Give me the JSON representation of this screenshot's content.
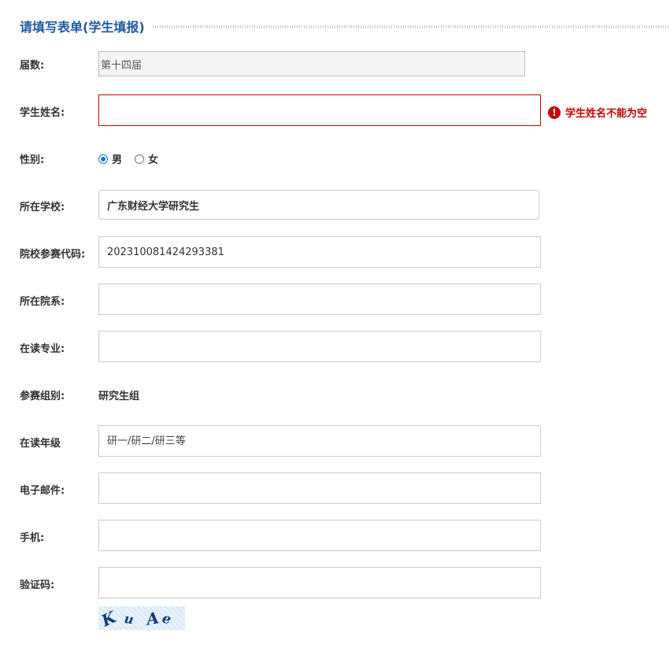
{
  "section": {
    "title": "请填写表单(学生填报)"
  },
  "form": {
    "session": {
      "label": "届数:",
      "value": "第十四届"
    },
    "student_name": {
      "label": "学生姓名:",
      "value": "",
      "error": "学生姓名不能为空",
      "error_icon": "exclamation-icon"
    },
    "gender": {
      "label": "性别:",
      "options": [
        "男",
        "女"
      ],
      "selected": "男"
    },
    "school": {
      "label": "所在学校:",
      "value": "广东财经大学研究生"
    },
    "school_code": {
      "label": "院校参赛代码:",
      "value": "202310081424293381"
    },
    "department": {
      "label": "所在院系:",
      "value": ""
    },
    "major": {
      "label": "在读专业:",
      "value": ""
    },
    "group": {
      "label": "参赛组别:",
      "value": "研究生组"
    },
    "grade": {
      "label": "在读年级",
      "placeholder": "研一/研二/研三等",
      "value": ""
    },
    "email": {
      "label": "电子邮件:",
      "value": ""
    },
    "phone": {
      "label": "手机:",
      "value": ""
    },
    "captcha": {
      "label": "验证码:",
      "value": "",
      "image_text": "KuAe"
    }
  },
  "colors": {
    "title": "#1f5aa6",
    "error": "#cc0000",
    "radio_accent": "#1a73e8",
    "border": "#cccccc"
  }
}
